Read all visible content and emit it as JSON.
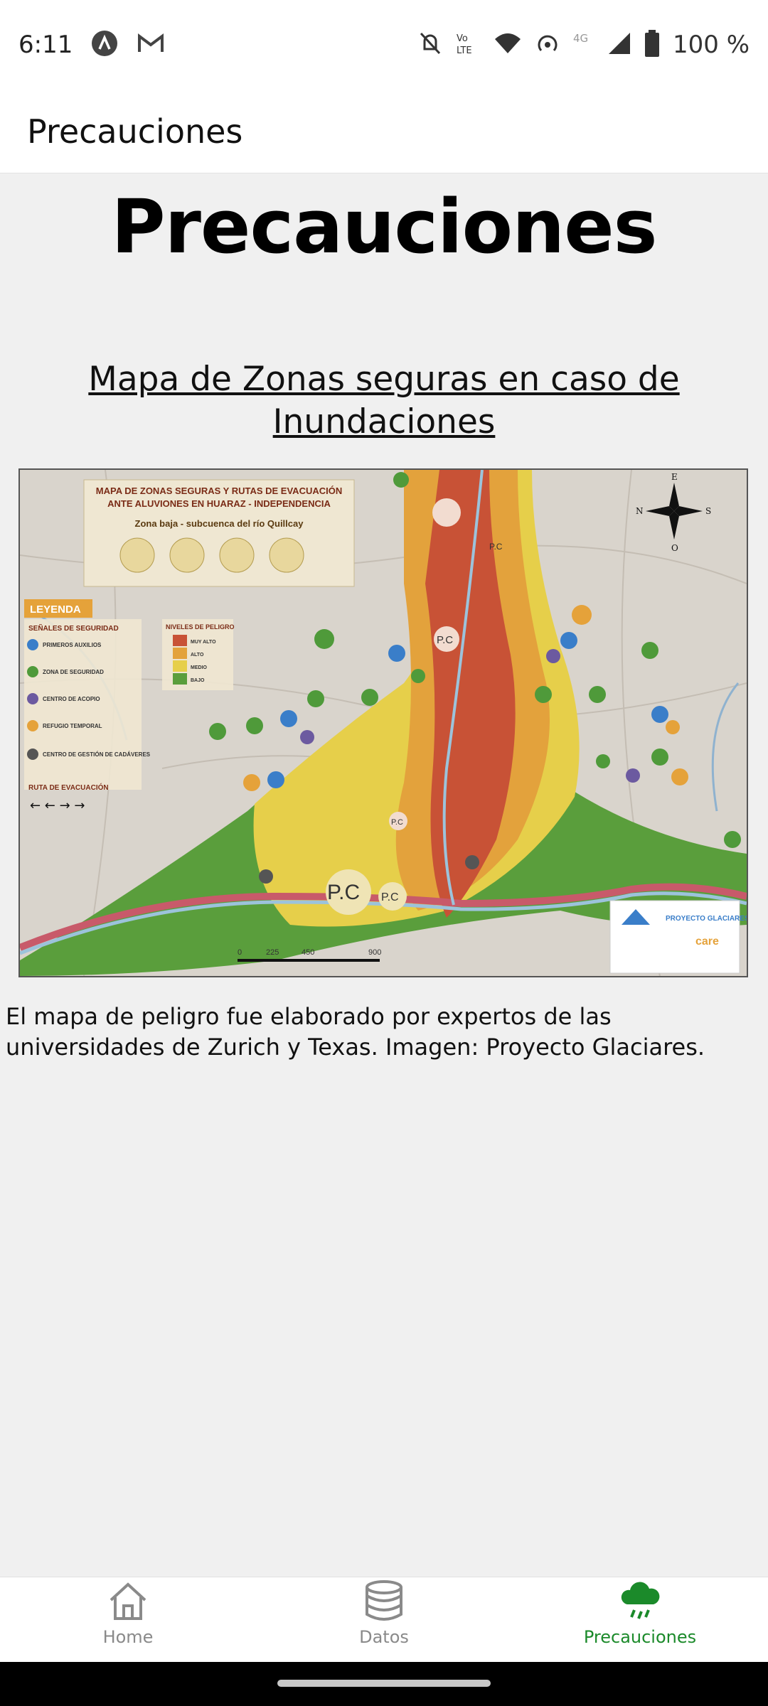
{
  "status_bar": {
    "time": "6:11",
    "battery": "100 %",
    "icons": [
      "app-a-icon",
      "gmail-icon",
      "silent-icon",
      "volte-icon",
      "wifi-icon",
      "hotspot-icon",
      "4g-icon",
      "signal-icon",
      "battery-icon"
    ]
  },
  "app_bar": {
    "title": "Precauciones"
  },
  "main": {
    "heading": "Precauciones",
    "map_link": "Mapa de Zonas seguras en caso de Inundaciones",
    "caption": "El mapa de peligro fue elaborado por expertos de las universidades de Zurich y Texas. Imagen: Proyecto Glaciares."
  },
  "map": {
    "title_line1": "MAPA DE ZONAS SEGURAS Y RUTAS DE EVACUACIÓN",
    "title_line2": "ANTE ALUVIONES EN HUARAZ - INDEPENDENCIA",
    "subtitle": "Zona baja - subcuenca del río Quillcay",
    "legend_title": "LEYENDA",
    "legend_safety": "SEÑALES DE SEGURIDAD",
    "legend_danger": "NIVELES DE PELIGRO",
    "danger_levels": [
      "MUY ALTO",
      "ALTO",
      "MEDIO",
      "BAJO"
    ],
    "legend_items": [
      "PRIMEROS AUXILIOS",
      "ZONA DE SEGURIDAD",
      "CENTRO DE ACOPIO",
      "REFUGIO TEMPORAL",
      "CENTRO DE GESTIÓN DE CADÁVERES"
    ],
    "route_label": "RUTA DE EVACUACIÓN",
    "pc_label": "P.C",
    "scale_labels": [
      "0",
      "225",
      "450",
      "900"
    ],
    "compass_labels": [
      "E",
      "N",
      "S",
      "O"
    ],
    "credit_left": "PROYECTO GLACIARES",
    "credit_right": "care",
    "colors": {
      "very_high": "#c9503a",
      "high": "#e5a23a",
      "medium": "#e8d04a",
      "low": "#4f9a3a",
      "river": "#7aa6c9",
      "base": "#d8d3cb"
    }
  },
  "bottom_nav": {
    "items": [
      {
        "label": "Home",
        "icon": "home-icon",
        "active": false
      },
      {
        "label": "Datos",
        "icon": "database-icon",
        "active": false
      },
      {
        "label": "Precauciones",
        "icon": "rain-cloud-icon",
        "active": true
      }
    ],
    "active_color": "#1b8a2a"
  }
}
